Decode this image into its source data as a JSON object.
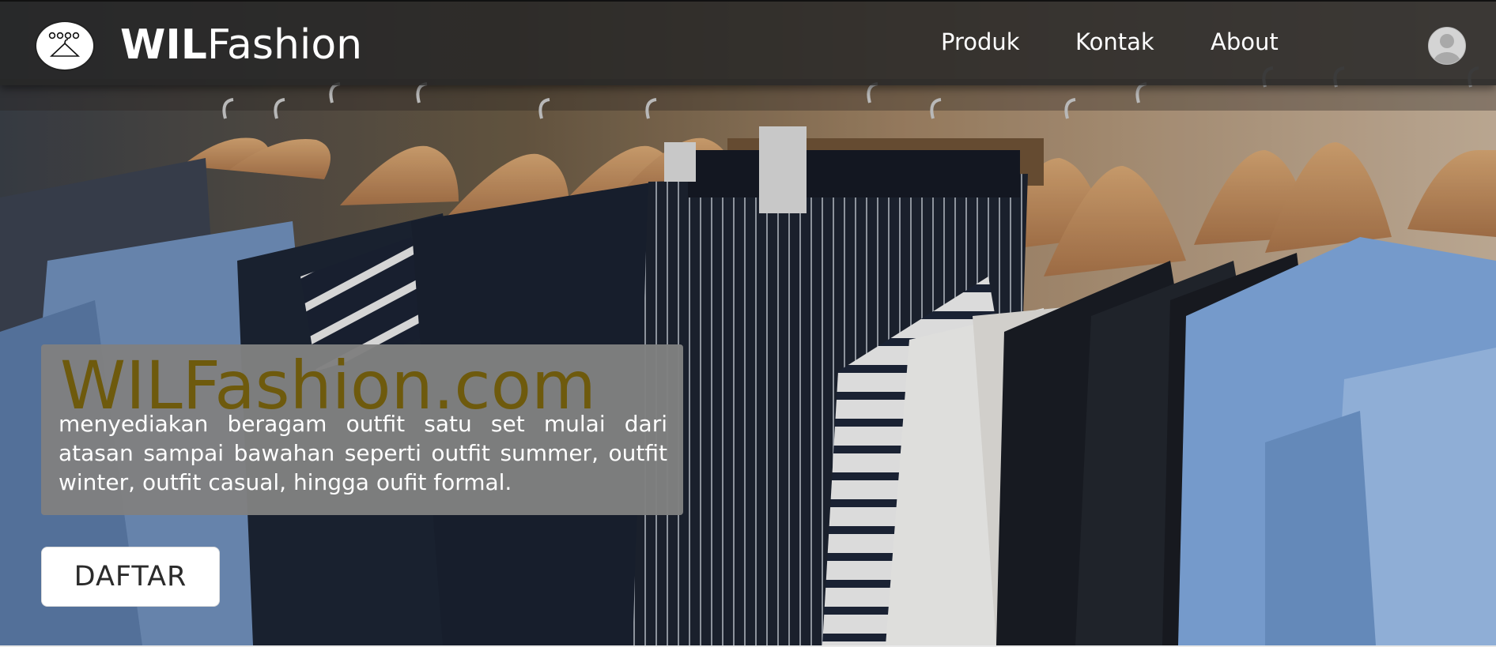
{
  "header": {
    "brand_bold": "WIL",
    "brand_light": "Fashion",
    "nav": [
      "Produk",
      "Kontak",
      "About"
    ]
  },
  "hero": {
    "title": "WILFashion.com",
    "description": "menyediakan beragam outfit satu set mulai dari atasan sampai bawahan seperti outfit summer, outfit winter, outfit casual, hingga oufit formal.",
    "cta_label": "DAFTAR",
    "background": "clothes-on-hangers-photo"
  },
  "icons": {
    "logo": "hanger-logo-icon",
    "account": "user-avatar-icon"
  },
  "colors": {
    "header_bg": "#262626",
    "title": "#6e5a0d",
    "card_bg": "#808080",
    "button_bg": "#ffffff"
  }
}
